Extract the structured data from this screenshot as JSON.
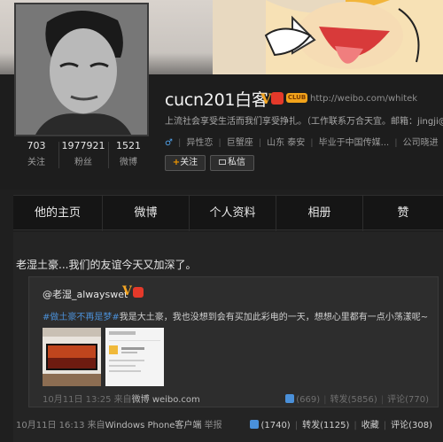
{
  "profile": {
    "name": "cucn201白客",
    "v_badge": "V",
    "club_badge": "CLUB",
    "url": "http://weibo.com/whitek",
    "bio": "上流社会享受生活而我们享受挣扎。（工作联系万合天宜。邮箱：jingji@",
    "gender_symbol": "♂",
    "meta": [
      "异性恋",
      "巨蟹座",
      "山东 泰安",
      "毕业于中国传媒...",
      "公司晓进"
    ],
    "follow_label": "关注",
    "message_label": "私信",
    "stats": [
      {
        "value": "703",
        "label": "关注"
      },
      {
        "value": "1977921",
        "label": "粉丝"
      },
      {
        "value": "1521",
        "label": "微博"
      }
    ]
  },
  "tabs": [
    "他的主页",
    "微博",
    "个人资料",
    "相册",
    "赞"
  ],
  "post": {
    "text": "老湿土豪...我们的友谊今天又加深了。",
    "repost": {
      "author": "@老湿_alwayswet",
      "v_badge": "V",
      "topic": "#做土豪不再是梦#",
      "text": "我是大土豪，我也没想到会有买加此彩电的一天，想想心里都有一点小荡漾呢~",
      "time": "10月11日 13:25",
      "source_prefix": "来自",
      "source": "微博 weibo.com",
      "likes": "(669)",
      "reposts": "转发(5856)",
      "comments": "评论(770)"
    },
    "time": "10月11日 16:13",
    "source_prefix": "来自",
    "source": "Windows Phone客户端",
    "report": "举报",
    "likes": "(1740)",
    "reposts": "转发(1125)",
    "favorite": "收藏",
    "comments": "评论(308)"
  }
}
